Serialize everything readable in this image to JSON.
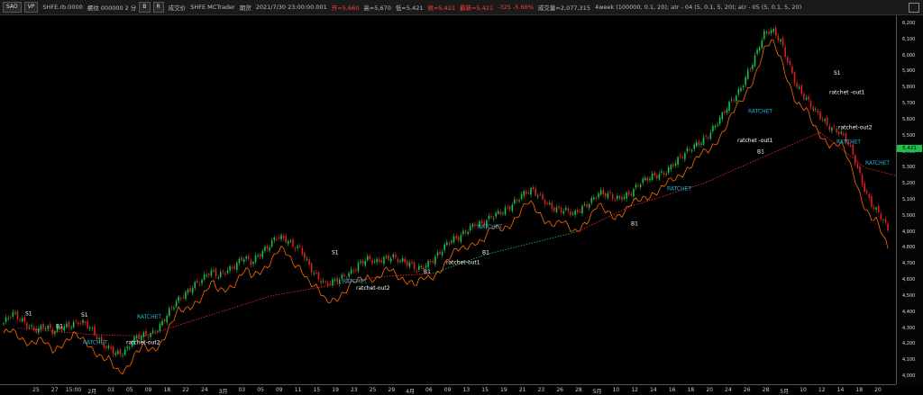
{
  "header": {
    "btn1": "SAO",
    "btn2": "VP",
    "symbol": "SHFE.rb.0000",
    "interval": "螺纹 000000  2 分",
    "b1": "B",
    "b2": "R",
    "exchange": "成交价",
    "source": "SHFE  MCTrader",
    "mode": "期货",
    "datetime": "2021/7/30  23:00:00.001",
    "open": "开=5,660",
    "high": "高=5,670",
    "low": "低=5,421",
    "close": "收=5,421",
    "last": "最新=5,421",
    "change": "-325  -5.66%",
    "volume": "成交量=2,077,315",
    "studies": "4week (100000, 0.1, 20);  atr - 04 (5, 0.1, 5, 20);  atr - 05 (5, 0.1, 5, 20)"
  },
  "y_axis": {
    "labels": [
      "6,200",
      "6,100",
      "6,000",
      "5,900",
      "5,800",
      "5,700",
      "5,600",
      "5,500",
      "5,400",
      "5,300",
      "5,200",
      "5,100",
      "5,000",
      "4,900",
      "4,800",
      "4,700",
      "4,600",
      "4,500",
      "4,400",
      "4,300",
      "4,200",
      "4,100",
      "4,000"
    ],
    "last_price": "5,421"
  },
  "x_axis": {
    "labels": [
      "25",
      "27",
      "15:00",
      "2月",
      "03",
      "05",
      "09",
      "18",
      "22",
      "24",
      "3月",
      "03",
      "05",
      "09",
      "11",
      "15",
      "19",
      "23",
      "25",
      "29",
      "4月",
      "06",
      "09",
      "13",
      "15",
      "19",
      "21",
      "23",
      "26",
      "28",
      "5月",
      "10",
      "12",
      "14",
      "16",
      "18",
      "20",
      "24",
      "26",
      "28",
      "5月",
      "10",
      "12",
      "14",
      "18",
      "20"
    ]
  },
  "colors": {
    "up": "#19c24b",
    "down": "#e02020",
    "line": "#ff6a00",
    "trail": "#ff2a2a",
    "ratchet": "#1fb6d8"
  },
  "chart_data": {
    "type": "candlestick",
    "yrange": [
      3950,
      6250
    ],
    "closes": [
      4330,
      4380,
      4350,
      4320,
      4300,
      4310,
      4260,
      4300,
      4330,
      4350,
      4320,
      4250,
      4200,
      4180,
      4140,
      4160,
      4230,
      4260,
      4280,
      4320,
      4390,
      4460,
      4520,
      4580,
      4600,
      4640,
      4620,
      4670,
      4700,
      4740,
      4690,
      4760,
      4820,
      4880,
      4850,
      4800,
      4790,
      4700,
      4620,
      4560,
      4580,
      4620,
      4660,
      4700,
      4720,
      4700,
      4740,
      4760,
      4720,
      4690,
      4660,
      4700,
      4740,
      4780,
      4830,
      4860,
      4920,
      4960,
      4940,
      4980,
      5020,
      5060,
      5100,
      5130,
      5150,
      5120,
      5080,
      5040,
      5020,
      5000,
      5060,
      5100,
      5140,
      5120,
      5100,
      5130,
      5160,
      5200,
      5220,
      5250,
      5280,
      5330,
      5360,
      5400,
      5450,
      5500,
      5560,
      5620,
      5700,
      5780,
      5900,
      6000,
      6120,
      6150,
      6100,
      5960,
      5800,
      5720,
      5660,
      5620,
      5560,
      5520,
      5460,
      5350,
      5200,
      5080,
      5000,
      4900
    ],
    "annotations": [
      "S1",
      "B1",
      "RATCHET",
      "ratchet-out2",
      "ratchet-out1",
      "ratchet -out1"
    ]
  }
}
